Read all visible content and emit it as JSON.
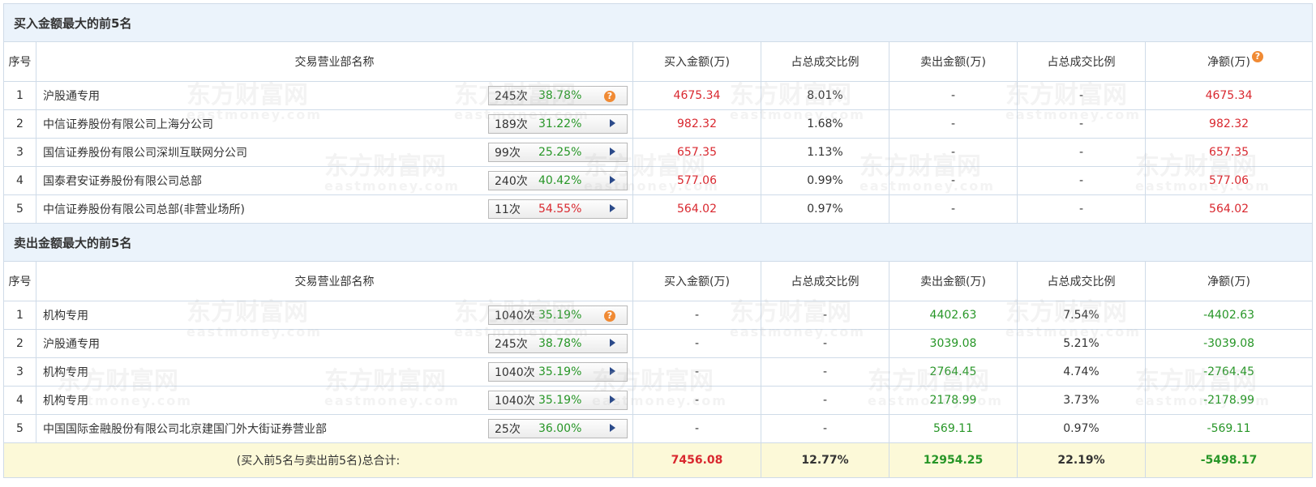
{
  "buy_section": {
    "title": "买入金额最大的前5名",
    "headers": [
      "序号",
      "交易营业部名称",
      "买入金额(万)",
      "占总成交比例",
      "卖出金额(万)",
      "占总成交比例",
      "净额(万)"
    ],
    "rows": [
      {
        "idx": "1",
        "name": "沪股通专用",
        "count": "245次",
        "pct": "38.78%",
        "pct_color": "green",
        "icon": "help-icon",
        "buy": "4675.34",
        "buy_ratio": "8.01%",
        "sell": "-",
        "sell_ratio": "-",
        "net": "4675.34",
        "net_color": "red"
      },
      {
        "idx": "2",
        "name": "中信证券股份有限公司上海分公司",
        "count": "189次",
        "pct": "31.22%",
        "pct_color": "green",
        "icon": "play-arrow-icon",
        "buy": "982.32",
        "buy_ratio": "1.68%",
        "sell": "-",
        "sell_ratio": "-",
        "net": "982.32",
        "net_color": "red"
      },
      {
        "idx": "3",
        "name": "国信证券股份有限公司深圳互联网分公司",
        "count": "99次",
        "pct": "25.25%",
        "pct_color": "green",
        "icon": "play-arrow-icon",
        "buy": "657.35",
        "buy_ratio": "1.13%",
        "sell": "-",
        "sell_ratio": "-",
        "net": "657.35",
        "net_color": "red"
      },
      {
        "idx": "4",
        "name": "国泰君安证券股份有限公司总部",
        "count": "240次",
        "pct": "40.42%",
        "pct_color": "green",
        "icon": "play-arrow-icon",
        "buy": "577.06",
        "buy_ratio": "0.99%",
        "sell": "-",
        "sell_ratio": "-",
        "net": "577.06",
        "net_color": "red"
      },
      {
        "idx": "5",
        "name": "中信证券股份有限公司总部(非营业场所)",
        "count": "11次",
        "pct": "54.55%",
        "pct_color": "red",
        "icon": "play-arrow-icon",
        "buy": "564.02",
        "buy_ratio": "0.97%",
        "sell": "-",
        "sell_ratio": "-",
        "net": "564.02",
        "net_color": "red"
      }
    ]
  },
  "sell_section": {
    "title": "卖出金额最大的前5名",
    "headers": [
      "序号",
      "交易营业部名称",
      "买入金额(万)",
      "占总成交比例",
      "卖出金额(万)",
      "占总成交比例",
      "净额(万)"
    ],
    "rows": [
      {
        "idx": "1",
        "name": "机构专用",
        "count": "1040次",
        "pct": "35.19%",
        "pct_color": "green",
        "icon": "help-icon",
        "buy": "-",
        "buy_ratio": "-",
        "sell": "4402.63",
        "sell_ratio": "7.54%",
        "net": "-4402.63",
        "net_color": "green"
      },
      {
        "idx": "2",
        "name": "沪股通专用",
        "count": "245次",
        "pct": "38.78%",
        "pct_color": "green",
        "icon": "play-arrow-icon",
        "buy": "-",
        "buy_ratio": "-",
        "sell": "3039.08",
        "sell_ratio": "5.21%",
        "net": "-3039.08",
        "net_color": "green"
      },
      {
        "idx": "3",
        "name": "机构专用",
        "count": "1040次",
        "pct": "35.19%",
        "pct_color": "green",
        "icon": "play-arrow-icon",
        "buy": "-",
        "buy_ratio": "-",
        "sell": "2764.45",
        "sell_ratio": "4.74%",
        "net": "-2764.45",
        "net_color": "green"
      },
      {
        "idx": "4",
        "name": "机构专用",
        "count": "1040次",
        "pct": "35.19%",
        "pct_color": "green",
        "icon": "play-arrow-icon",
        "buy": "-",
        "buy_ratio": "-",
        "sell": "2178.99",
        "sell_ratio": "3.73%",
        "net": "-2178.99",
        "net_color": "green"
      },
      {
        "idx": "5",
        "name": "中国国际金融股份有限公司北京建国门外大街证券营业部",
        "count": "25次",
        "pct": "36.00%",
        "pct_color": "green",
        "icon": "play-arrow-icon",
        "buy": "-",
        "buy_ratio": "-",
        "sell": "569.11",
        "sell_ratio": "0.97%",
        "net": "-569.11",
        "net_color": "green"
      }
    ]
  },
  "total": {
    "label": "(买入前5名与卖出前5名)总合计:",
    "buy": "7456.08",
    "buy_ratio": "12.77%",
    "sell": "12954.25",
    "sell_ratio": "22.19%",
    "net": "-5498.17"
  },
  "watermark": {
    "cn": "东方财富网",
    "en": "eastmoney.com"
  },
  "colors": {
    "red": "#d9282f",
    "green": "#279627",
    "header_bg": "#ebf3fb",
    "total_bg": "#fcf9d8",
    "help_orange": "#f08a34"
  }
}
